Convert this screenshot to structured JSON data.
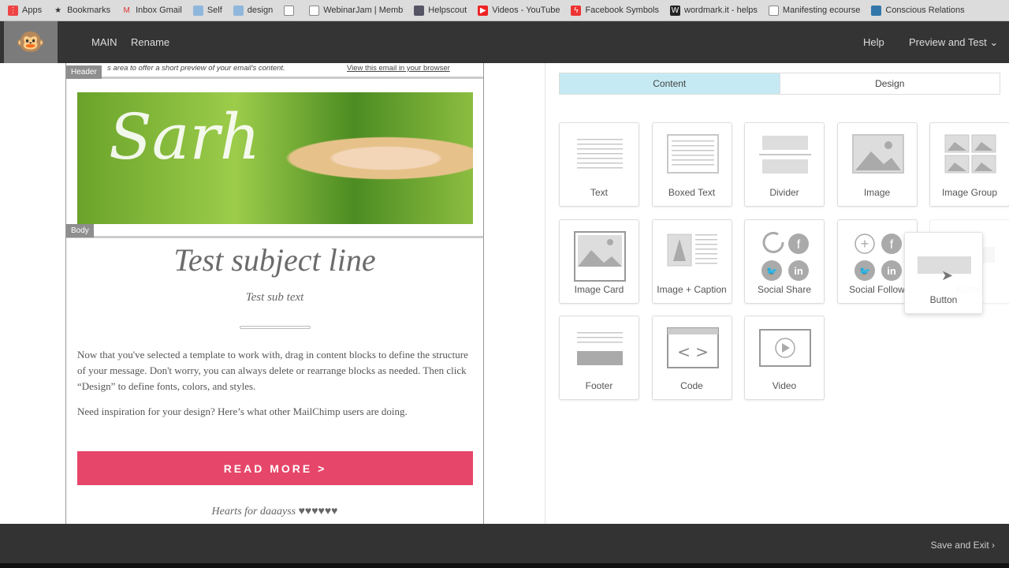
{
  "bookmarks": [
    {
      "label": "Apps",
      "icon": "apps-grid-icon"
    },
    {
      "label": "Bookmarks",
      "icon": "star-icon"
    },
    {
      "label": "Inbox Gmail",
      "icon": "gmail-icon"
    },
    {
      "label": "Self",
      "icon": "folder-icon"
    },
    {
      "label": "design",
      "icon": "folder-icon"
    },
    {
      "label": "",
      "icon": "page-icon"
    },
    {
      "label": "WebinarJam | Memb",
      "icon": "page-icon"
    },
    {
      "label": "Helpscout",
      "icon": "helpscout-icon"
    },
    {
      "label": "Videos - YouTube",
      "icon": "youtube-icon"
    },
    {
      "label": "Facebook Symbols",
      "icon": "facebook-symbols-icon"
    },
    {
      "label": "wordmark.it - helps",
      "icon": "wordmark-icon"
    },
    {
      "label": "Manifesting ecourse",
      "icon": "page-icon"
    },
    {
      "label": "Conscious Relations",
      "icon": "site-icon"
    }
  ],
  "nav": {
    "main": "MAIN",
    "rename": "Rename",
    "help": "Help",
    "preview": "Preview and Test",
    "save_exit": "Save and Exit"
  },
  "email": {
    "header_tag": "Header",
    "body_tag": "Body",
    "preheader": "s area to offer a short preview of your email's content.",
    "view_browser": "View this email in your browser",
    "title": "Test subject line",
    "subtitle": "Test sub text",
    "para1": "Now that you've selected a template to work with, drag in content blocks to define the structure of your message. Don't worry, you can always delete or rearrange blocks as needed. Then click “Design” to define fonts, colors, and styles.",
    "para2": "Need inspiration for your design? Here’s what other MailChimp users are doing.",
    "button": "READ MORE >",
    "hearts": "Hearts for daaayss ♥♥♥♥♥♥",
    "button_color": "#e64669"
  },
  "panel": {
    "tabs": [
      {
        "label": "Content",
        "active": true
      },
      {
        "label": "Design",
        "active": false
      }
    ],
    "blocks": [
      "Text",
      "Boxed Text",
      "Divider",
      "Image",
      "Image Group",
      "Image Card",
      "Image + Caption",
      "Social Share",
      "Social Follow",
      "Button",
      "Footer",
      "Code",
      "Video"
    ],
    "dragging": "Button"
  }
}
